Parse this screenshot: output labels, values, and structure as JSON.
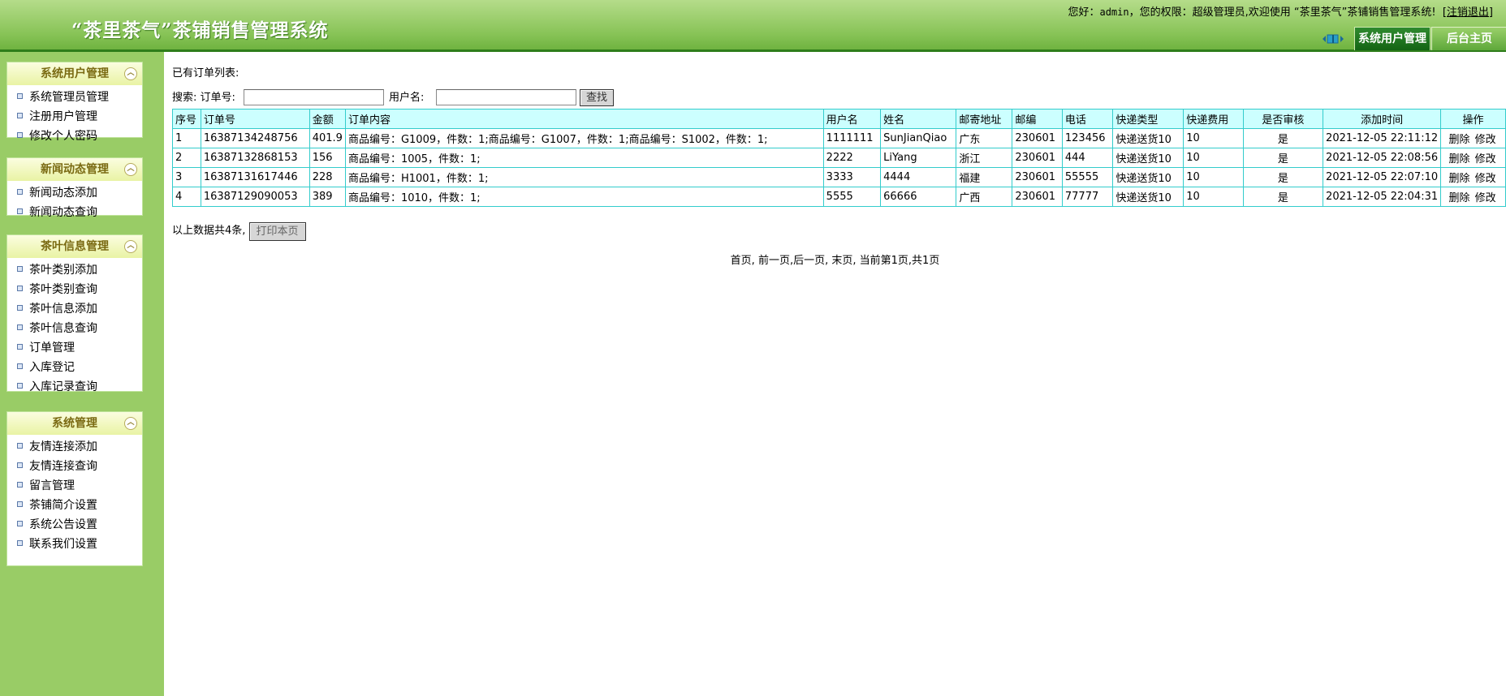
{
  "header": {
    "app_title": "“茶里茶气”茶铺销售管理系统",
    "greeting_prefix": "您好：",
    "username": "admin",
    "role_prefix": "，您的权限：",
    "role": "超级管理员",
    "welcome_suffix": ",欢迎使用 “茶里茶气”茶铺销售管理系统!",
    "logout_label": "[注销退出]",
    "tab_user": "系统用户管理",
    "tab_home": "后台主页"
  },
  "sidebar": {
    "groups": [
      {
        "title": "系统用户管理",
        "items": [
          "系统管理员管理",
          "注册用户管理",
          "修改个人密码"
        ]
      },
      {
        "title": "新闻动态管理",
        "items": [
          "新闻动态添加",
          "新闻动态查询"
        ]
      },
      {
        "title": "茶叶信息管理",
        "items": [
          "茶叶类别添加",
          "茶叶类别查询",
          "茶叶信息添加",
          "茶叶信息查询",
          "订单管理",
          "入库登记",
          "入库记录查询"
        ]
      },
      {
        "title": "系统管理",
        "items": [
          "友情连接添加",
          "友情连接查询",
          "留言管理",
          "茶铺简介设置",
          "系统公告设置",
          "联系我们设置"
        ]
      }
    ]
  },
  "main": {
    "list_title": "已有订单列表:",
    "search": {
      "label": "搜索: 订单号:",
      "order_no_value": "",
      "username_label": "用户名:",
      "username_value": "",
      "button": "查找"
    },
    "table": {
      "headers": [
        "序号",
        "订单号",
        "金额",
        "订单内容",
        "用户名",
        "姓名",
        "邮寄地址",
        "邮编",
        "电话",
        "快递类型",
        "快递费用",
        "是否审核",
        "添加时间",
        "操作"
      ],
      "rows": [
        [
          "1",
          "16387134248756",
          "401.9",
          "商品编号：G1009，件数：1;商品编号：G1007，件数：1;商品编号：S1002，件数：1;",
          "1111111",
          "SunJianQiao",
          "广东",
          "230601",
          "123456",
          "快递送货10",
          "10",
          "是",
          "2021-12-05 22:11:12"
        ],
        [
          "2",
          "16387132868153",
          "156",
          "商品编号：1005，件数：1;",
          "2222",
          "LiYang",
          "浙江",
          "230601",
          "444",
          "快递送货10",
          "10",
          "是",
          "2021-12-05 22:08:56"
        ],
        [
          "3",
          "16387131617446",
          "228",
          "商品编号：H1001，件数：1;",
          "3333",
          "4444",
          "福建",
          "230601",
          "55555",
          "快递送货10",
          "10",
          "是",
          "2021-12-05 22:07:10"
        ],
        [
          "4",
          "16387129090053",
          "389",
          "商品编号：1010，件数：1;",
          "5555",
          "66666",
          "广西",
          "230601",
          "77777",
          "快递送货10",
          "10",
          "是",
          "2021-12-05 22:04:31"
        ]
      ],
      "op_delete": "删除",
      "op_edit": "修改"
    },
    "summary_text": "以上数据共4条,",
    "print_button": "打印本页",
    "pager": {
      "first": "首页,",
      "prev": "前一页",
      "next": ",后一页,",
      "last": "末页,",
      "info": "当前第1页,共1页"
    }
  }
}
